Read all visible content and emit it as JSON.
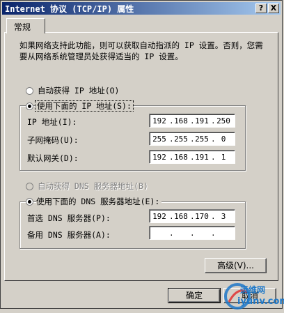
{
  "window": {
    "title": "Internet 协议 (TCP/IP) 属性",
    "help_label": "?",
    "close_label": "X"
  },
  "tabs": [
    {
      "label": "常规"
    }
  ],
  "description": "如果网络支持此功能，则可以获取自动指派的 IP 设置。否则，您需要从网络系统管理员处获得适当的 IP 设置。",
  "ip_section": {
    "auto_label": "自动获得 IP 地址(O)",
    "manual_label": "使用下面的 IP 地址(S):",
    "selected": "manual",
    "fields": [
      {
        "label": "IP 地址(I):",
        "octets": [
          "192",
          "168",
          "191",
          "250"
        ]
      },
      {
        "label": "子网掩码(U):",
        "octets": [
          "255",
          "255",
          "255",
          "0"
        ]
      },
      {
        "label": "默认网关(D):",
        "octets": [
          "192",
          "168",
          "191",
          "1"
        ]
      }
    ]
  },
  "dns_section": {
    "auto_label": "自动获得 DNS 服务器地址(B)",
    "manual_label": "使用下面的 DNS 服务器地址(E):",
    "selected": "manual",
    "fields": [
      {
        "label": "首选 DNS 服务器(P):",
        "octets": [
          "192",
          "168",
          "170",
          "3"
        ]
      },
      {
        "label": "备用 DNS 服务器(A):",
        "octets": [
          "",
          "",
          "",
          ""
        ]
      }
    ]
  },
  "buttons": {
    "advanced": "高级(V)...",
    "ok": "确定",
    "cancel": "取消"
  },
  "watermark": {
    "brand": "运维网",
    "url": "iyunv.com"
  }
}
